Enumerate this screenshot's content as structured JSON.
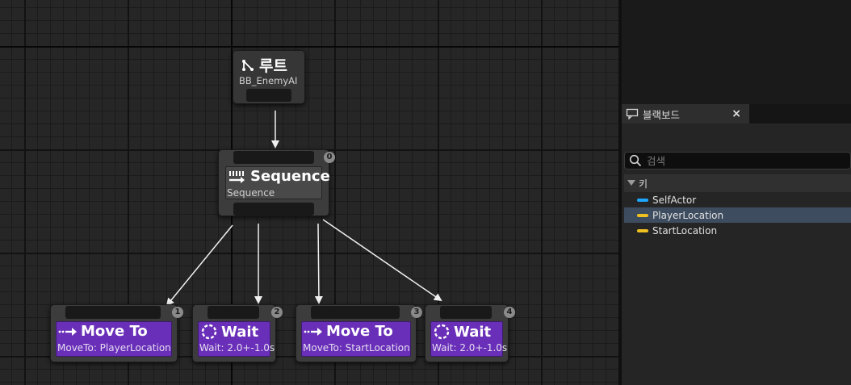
{
  "graph": {
    "root": {
      "title": "루트",
      "subtitle": "BB_EnemyAI"
    },
    "sequence": {
      "title": "Sequence",
      "subtitle": "Sequence",
      "index": "0"
    },
    "tasks": [
      {
        "index": "1",
        "title": "Move To",
        "subtitle": "MoveTo: PlayerLocation",
        "icon": "move-to-icon"
      },
      {
        "index": "2",
        "title": "Wait",
        "subtitle": "Wait: 2.0+-1.0s",
        "icon": "wait-icon"
      },
      {
        "index": "3",
        "title": "Move To",
        "subtitle": "MoveTo: StartLocation",
        "icon": "move-to-icon"
      },
      {
        "index": "4",
        "title": "Wait",
        "subtitle": "Wait: 2.0+-1.0s",
        "icon": "wait-icon"
      }
    ]
  },
  "blackboard_panel": {
    "tab_label": "블랙보드",
    "close_label": "×",
    "search_placeholder": "검색",
    "keys_header": "키",
    "keys": [
      {
        "name": "SelfActor",
        "color": "#1ea7ff",
        "selected": false
      },
      {
        "name": "PlayerLocation",
        "color": "#f0c020",
        "selected": true
      },
      {
        "name": "StartLocation",
        "color": "#f0c020",
        "selected": false
      }
    ]
  },
  "colors": {
    "task_node": "#6a2fb8",
    "graph_background": "#262626",
    "selected_row": "#3e4c5f"
  }
}
